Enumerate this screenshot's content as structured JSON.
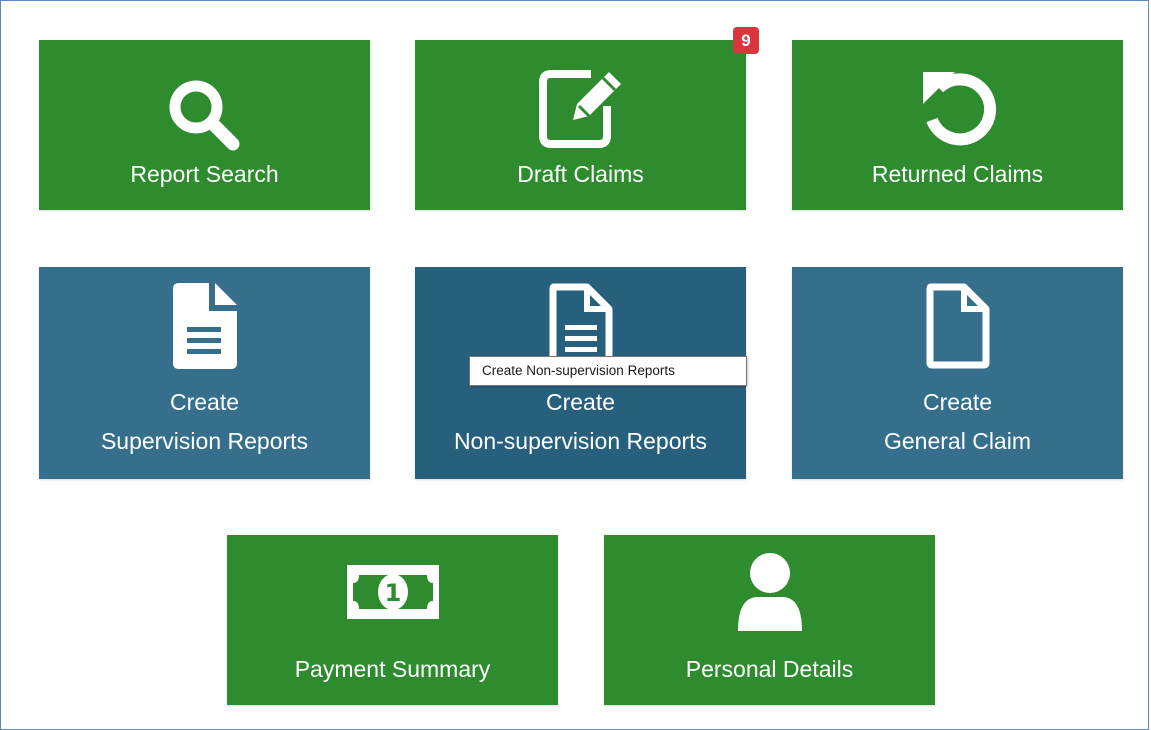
{
  "tiles": {
    "report_search": {
      "label": "Report Search",
      "icon": "search-icon"
    },
    "draft_claims": {
      "label": "Draft Claims",
      "icon": "edit-icon",
      "badge": "9"
    },
    "returned_claims": {
      "label": "Returned Claims",
      "icon": "undo-icon"
    },
    "create_supervision": {
      "line1": "Create",
      "line2": "Supervision Reports",
      "icon": "document-filled-icon"
    },
    "create_non_supervision": {
      "line1": "Create",
      "line2": "Non-supervision Reports",
      "icon": "document-outline-lines-icon"
    },
    "create_general": {
      "line1": "Create",
      "line2": "General Claim",
      "icon": "document-outline-icon"
    },
    "payment_summary": {
      "label": "Payment Summary",
      "icon": "banknote-icon"
    },
    "personal_details": {
      "label": "Personal Details",
      "icon": "user-icon"
    }
  },
  "tooltip": {
    "text": "Create Non-supervision Reports"
  },
  "colors": {
    "green": "#2e8b2e",
    "blue": "#356f8c",
    "blue_hover": "#27607c",
    "badge": "#d9353b"
  }
}
